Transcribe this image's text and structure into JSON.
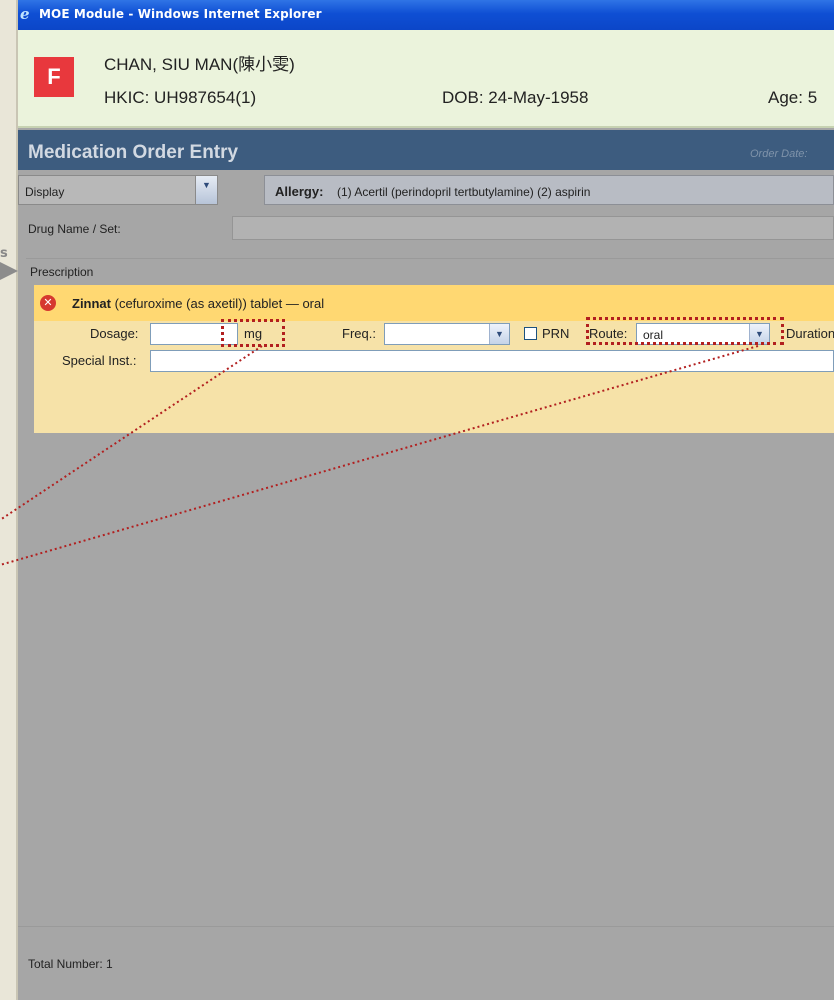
{
  "window": {
    "title": "MOE Module - Windows Internet Explorer"
  },
  "left_strip": {
    "glyph": "s"
  },
  "patient": {
    "sex": "F",
    "name": "CHAN, SIU MAN(陳小雯)",
    "hkic": "HKIC: UH987654(1)",
    "dob": "DOB: 24-May-1958",
    "age": "Age: 5"
  },
  "moe": {
    "title": "Medication Order Entry",
    "order_date_label": "Order Date:"
  },
  "display": {
    "value": "Display"
  },
  "allergy": {
    "label": "Allergy:",
    "text": "(1) Acertil (perindopril tertbutylamine) (2) aspirin"
  },
  "drug": {
    "label": "Drug Name / Set:"
  },
  "prescription": {
    "label": "Prescription",
    "drug_name": "Zinnat",
    "drug_desc": " (cefuroxime (as axetil)) tablet — oral",
    "dosage_label": "Dosage:",
    "dosage_unit": "mg",
    "freq_label": "Freq.:",
    "prn_label": "PRN",
    "route_label": "Route:",
    "route_value": "oral",
    "duration_label": "Duration",
    "special_label": "Special Inst.:"
  },
  "footer": {
    "total": "Total Number: 1"
  },
  "colors": {
    "annotation": "#b21f1f",
    "header": "#3d5c7f",
    "drug_bar": "#ffd872"
  }
}
